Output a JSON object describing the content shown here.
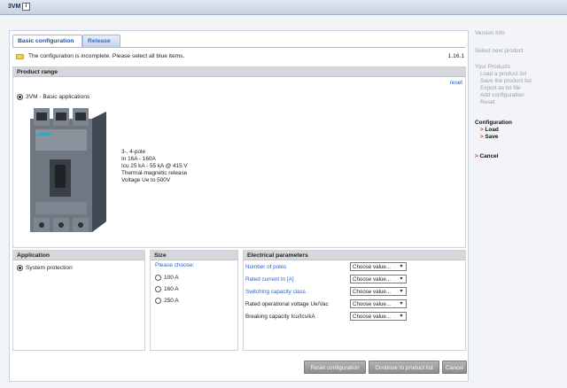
{
  "window": {
    "title": "3VM"
  },
  "tabs": [
    {
      "label": "Basic configuration"
    },
    {
      "label": "Release"
    }
  ],
  "notice": {
    "text": "The configuration is incomplete. Please select all blue items.",
    "version": "1.16.1"
  },
  "product_range": {
    "header": "Product range",
    "reset": "reset",
    "option": "3VM  -  Basic applications",
    "specs": [
      "3-, 4-pole",
      "In 16A - 160A",
      "Icu 25 kA  -  55 kA @ 415 V",
      "Thermal-magnetic release",
      "Voltage Ue to 500V"
    ]
  },
  "application": {
    "header": "Application",
    "option": "System protection"
  },
  "size": {
    "header": "Size",
    "prompt": "Please choose:",
    "options": [
      "100 A",
      "160 A",
      "250 A"
    ]
  },
  "electrical": {
    "header": "Electrical parameters",
    "rows": [
      {
        "label": "Number of poles",
        "value": "Choose value..."
      },
      {
        "label": "Rated current In [A]",
        "value": "Choose value..."
      },
      {
        "label": "Switching capacity class",
        "value": "Choose value..."
      },
      {
        "label": "Rated operational voltage Ue/Vac",
        "value": "Choose value..."
      },
      {
        "label": "Breaking capacity Icu/Ics/kA",
        "value": "Choose value..."
      }
    ]
  },
  "buttons": {
    "reset": "Reset configuration",
    "continue": "Continue to product list",
    "cancel": "Cancel"
  },
  "sidebar": {
    "version_info": "Version Info",
    "select_next": "Select next product",
    "your_products": "Your Products",
    "products_items": [
      "Load a product list",
      "Save the product list",
      "Export as txt file",
      "Add configuration",
      "Reset"
    ],
    "configuration": "Configuration",
    "load": "Load",
    "save": "Save",
    "cancel": "Cancel"
  }
}
